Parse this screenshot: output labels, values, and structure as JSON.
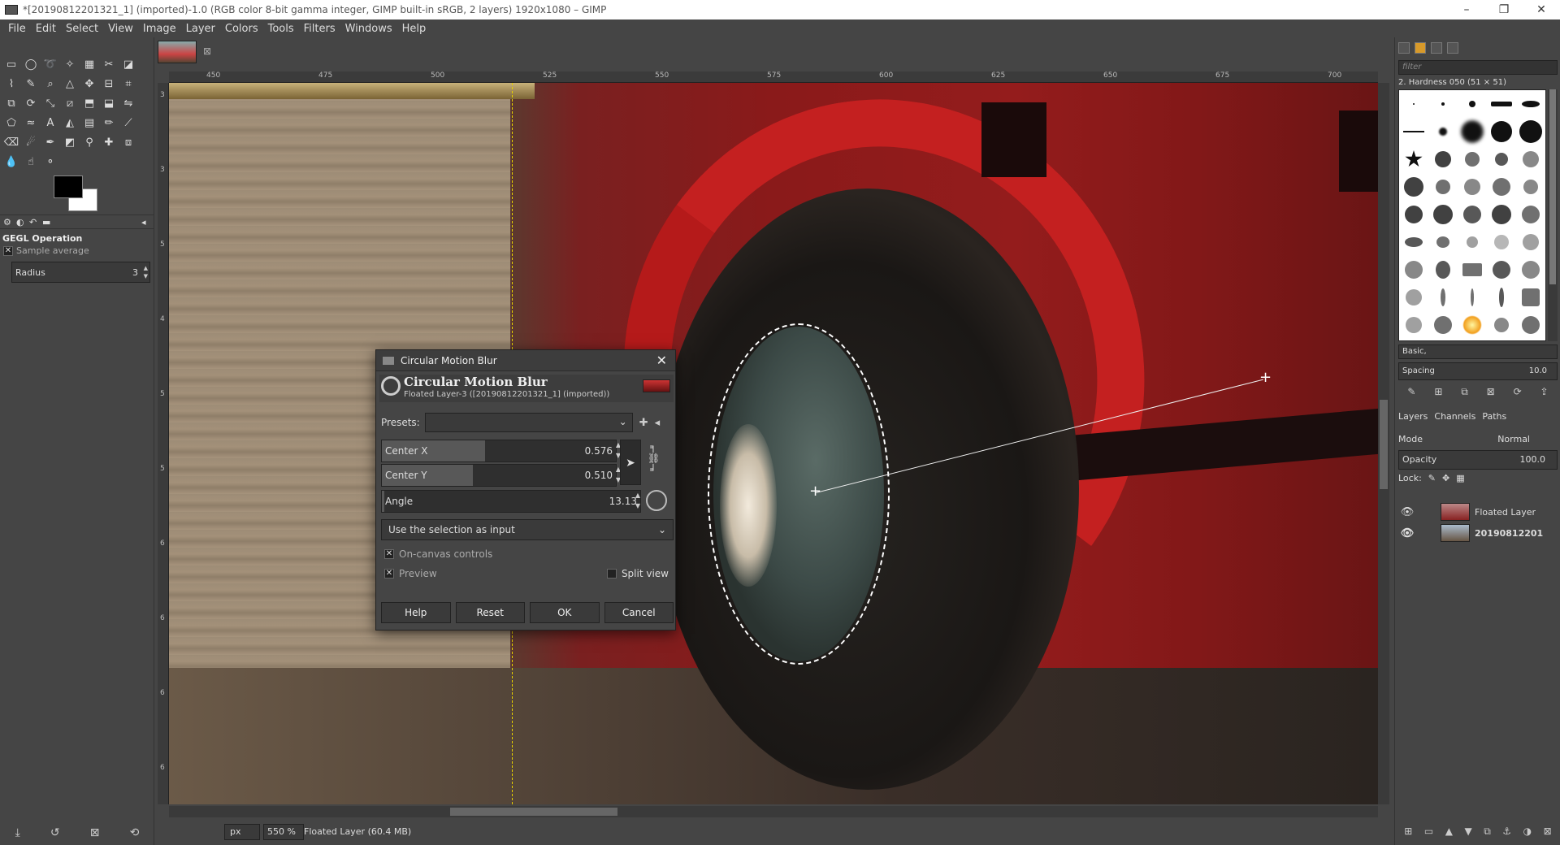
{
  "window": {
    "title": "*[20190812201321_1] (imported)-1.0 (RGB color 8-bit gamma integer, GIMP built-in sRGB, 2 layers) 1920x1080 – GIMP",
    "minimize": "–",
    "maximize": "❐",
    "close": "✕"
  },
  "menu": [
    "File",
    "Edit",
    "Select",
    "View",
    "Image",
    "Layer",
    "Colors",
    "Tools",
    "Filters",
    "Windows",
    "Help"
  ],
  "tool_options": {
    "title": "GEGL Operation",
    "sample_average": "Sample average",
    "radius_label": "Radius",
    "radius_value": "3"
  },
  "rulers": {
    "top": [
      "450",
      "475",
      "500",
      "525",
      "550",
      "575",
      "600",
      "625",
      "650",
      "675",
      "700"
    ],
    "left": [
      "3",
      "3",
      "5",
      "4",
      "5",
      "5",
      "6",
      "6",
      "6",
      "6"
    ]
  },
  "status": {
    "unit": "px",
    "zoom": "550 %",
    "message": "Floated Layer (60.4 MB)"
  },
  "brushes": {
    "filter_placeholder": "filter",
    "current": "2. Hardness 050 (51 × 51)",
    "preset": "Basic,",
    "spacing_label": "Spacing",
    "spacing_value": "10.0"
  },
  "layers_panel": {
    "tabs": [
      "Layers",
      "Channels",
      "Paths"
    ],
    "mode_label": "Mode",
    "mode_value": "Normal",
    "opacity_label": "Opacity",
    "opacity_value": "100.0",
    "lock_label": "Lock:",
    "layers": [
      {
        "name": "Floated Layer"
      },
      {
        "name": "20190812201"
      }
    ]
  },
  "dialog": {
    "title": "Circular Motion Blur",
    "heading": "Circular Motion Blur",
    "subheading": "Floated Layer-3 ([20190812201321_1] (imported))",
    "presets_label": "Presets:",
    "center_x_label": "Center X",
    "center_x_value": "0.576",
    "center_y_label": "Center Y",
    "center_y_value": "0.510",
    "angle_label": "Angle",
    "angle_value": "13.13",
    "input_mode": "Use the selection as input",
    "on_canvas": "On-canvas controls",
    "preview": "Preview",
    "split_view": "Split view",
    "buttons": {
      "help": "Help",
      "reset": "Reset",
      "ok": "OK",
      "cancel": "Cancel"
    }
  }
}
